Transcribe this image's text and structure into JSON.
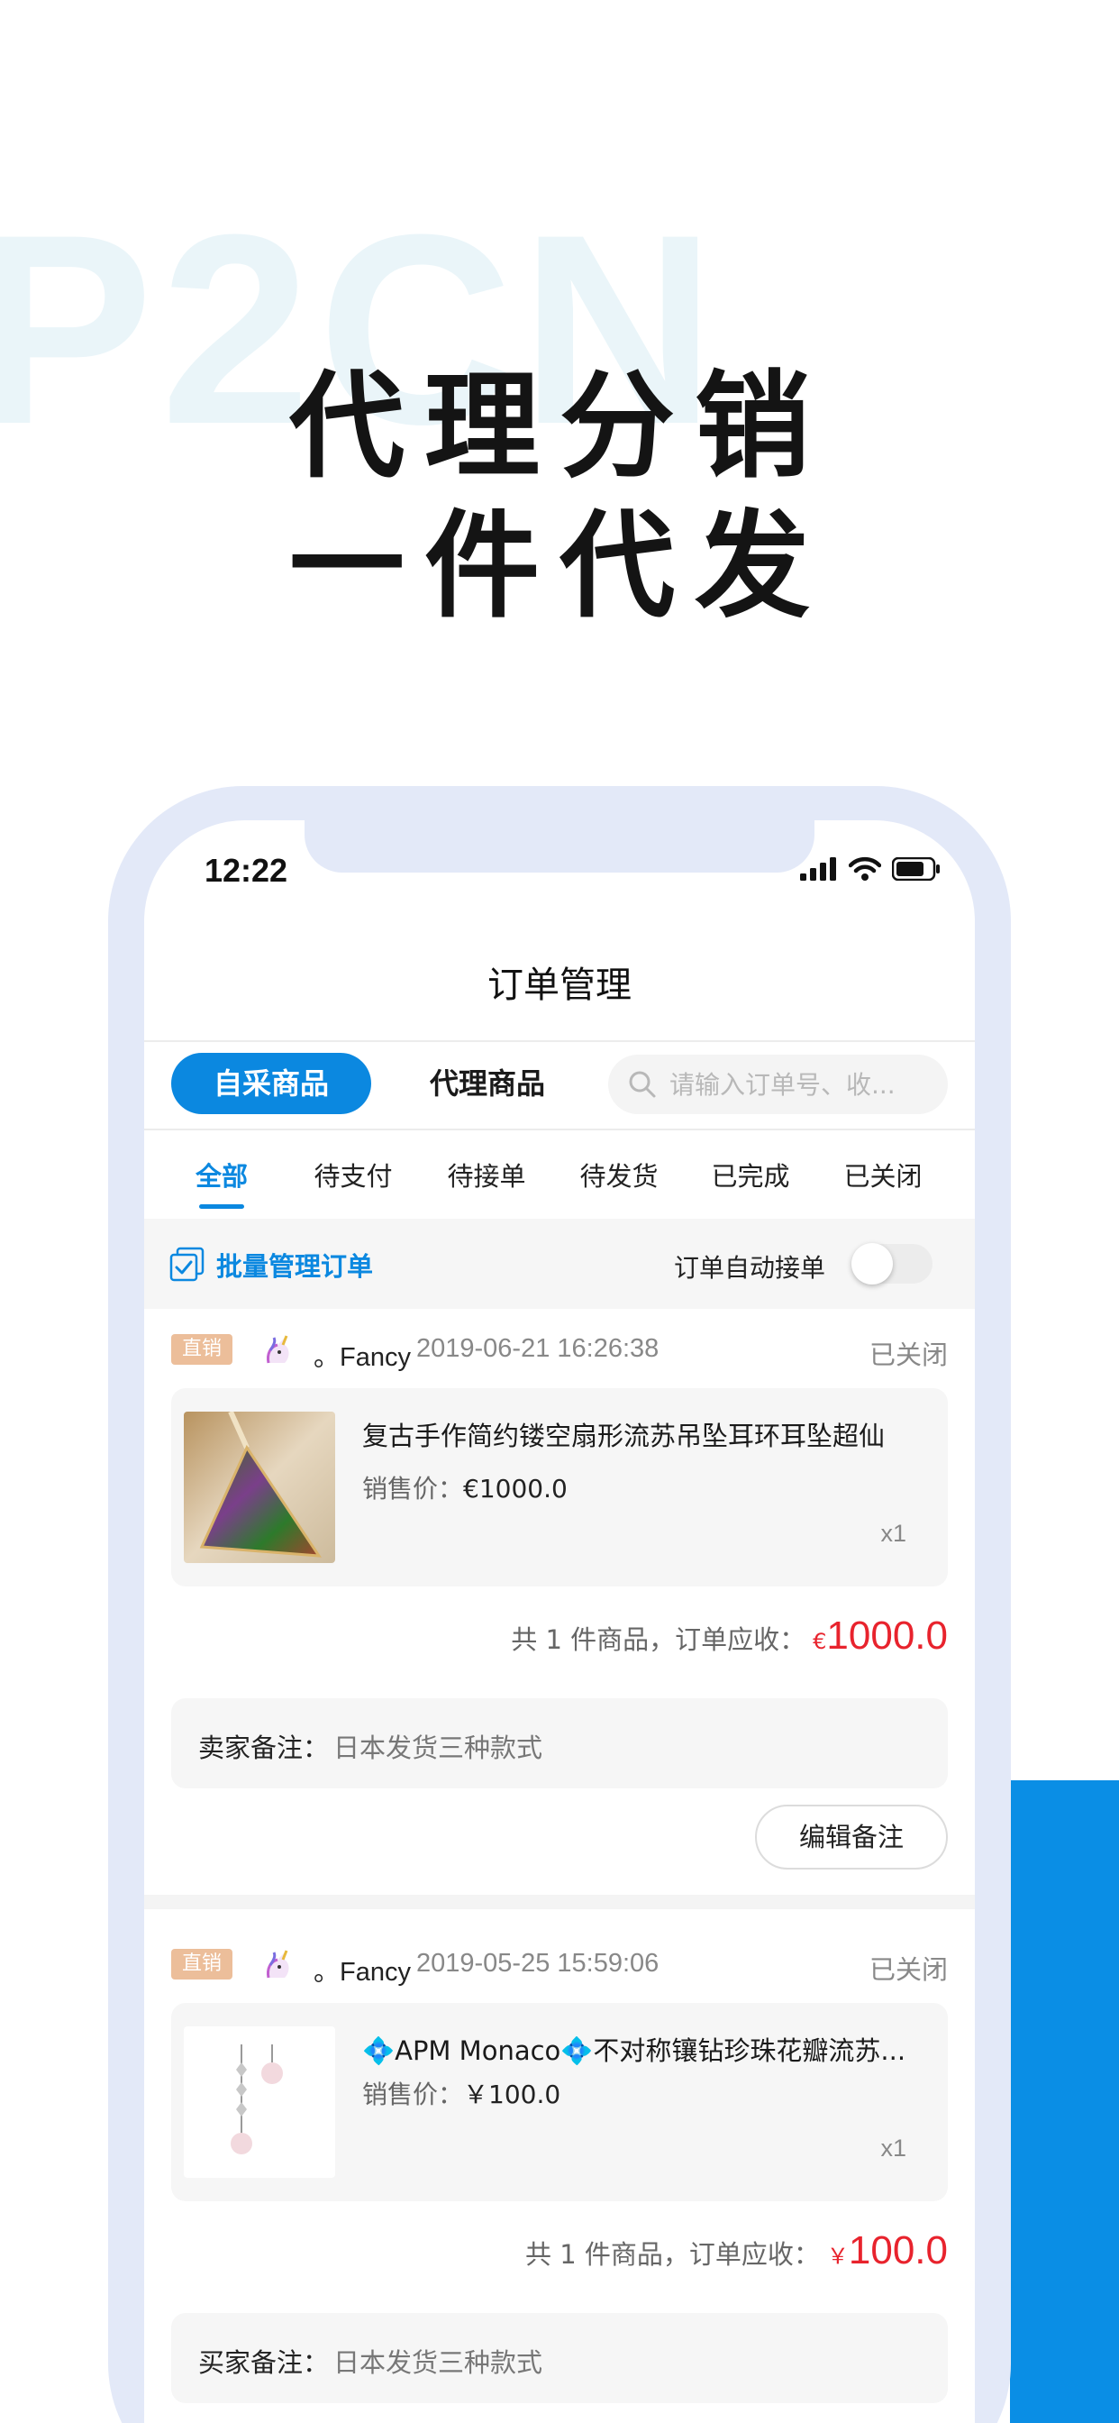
{
  "watermark": "P2CN",
  "headline": {
    "line1": "代理分销",
    "line2": "一件代发"
  },
  "status_bar": {
    "time": "12:22"
  },
  "nav": {
    "title": "订单管理"
  },
  "segments": {
    "self": "自采商品",
    "agent": "代理商品"
  },
  "search": {
    "placeholder": "请输入订单号、收..."
  },
  "tabs": [
    "全部",
    "待支付",
    "待接单",
    "待发货",
    "已完成",
    "已关闭"
  ],
  "batch": {
    "label": "批量管理订单",
    "auto_label": "订单自动接单",
    "auto_enabled": false
  },
  "orders": [
    {
      "badge": "直销",
      "store": "。Fancy",
      "time": "2019-06-21 16:26:38",
      "status": "已关闭",
      "item_title": "复古手作简约镂空扇形流苏吊坠耳环耳坠超仙",
      "price_label": "销售价：",
      "price_value": "€1000.0",
      "qty": "x1",
      "total_text": "共 1 件商品，订单应收：",
      "total_currency": "€",
      "total_amount": "1000.0",
      "remark_label": "卖家备注：",
      "remark_value": "日本发货三种款式",
      "edit_label": "编辑备注"
    },
    {
      "badge": "直销",
      "store": "。Fancy",
      "time": "2019-05-25 15:59:06",
      "status": "已关闭",
      "item_title": "💠APM Monaco💠不对称镶钻珍珠花瓣流苏...",
      "price_label": "销售价：",
      "price_value": "￥100.0",
      "qty": "x1",
      "total_text": "共 1 件商品，订单应收：",
      "total_currency": "￥",
      "total_amount": "100.0",
      "remark_label": "买家备注：",
      "remark_value": "日本发货三种款式"
    }
  ],
  "colors": {
    "accent": "#0b88e0",
    "price": "#e8232d",
    "badge": "#ecbe9a",
    "frame": "#e3e9f8"
  }
}
